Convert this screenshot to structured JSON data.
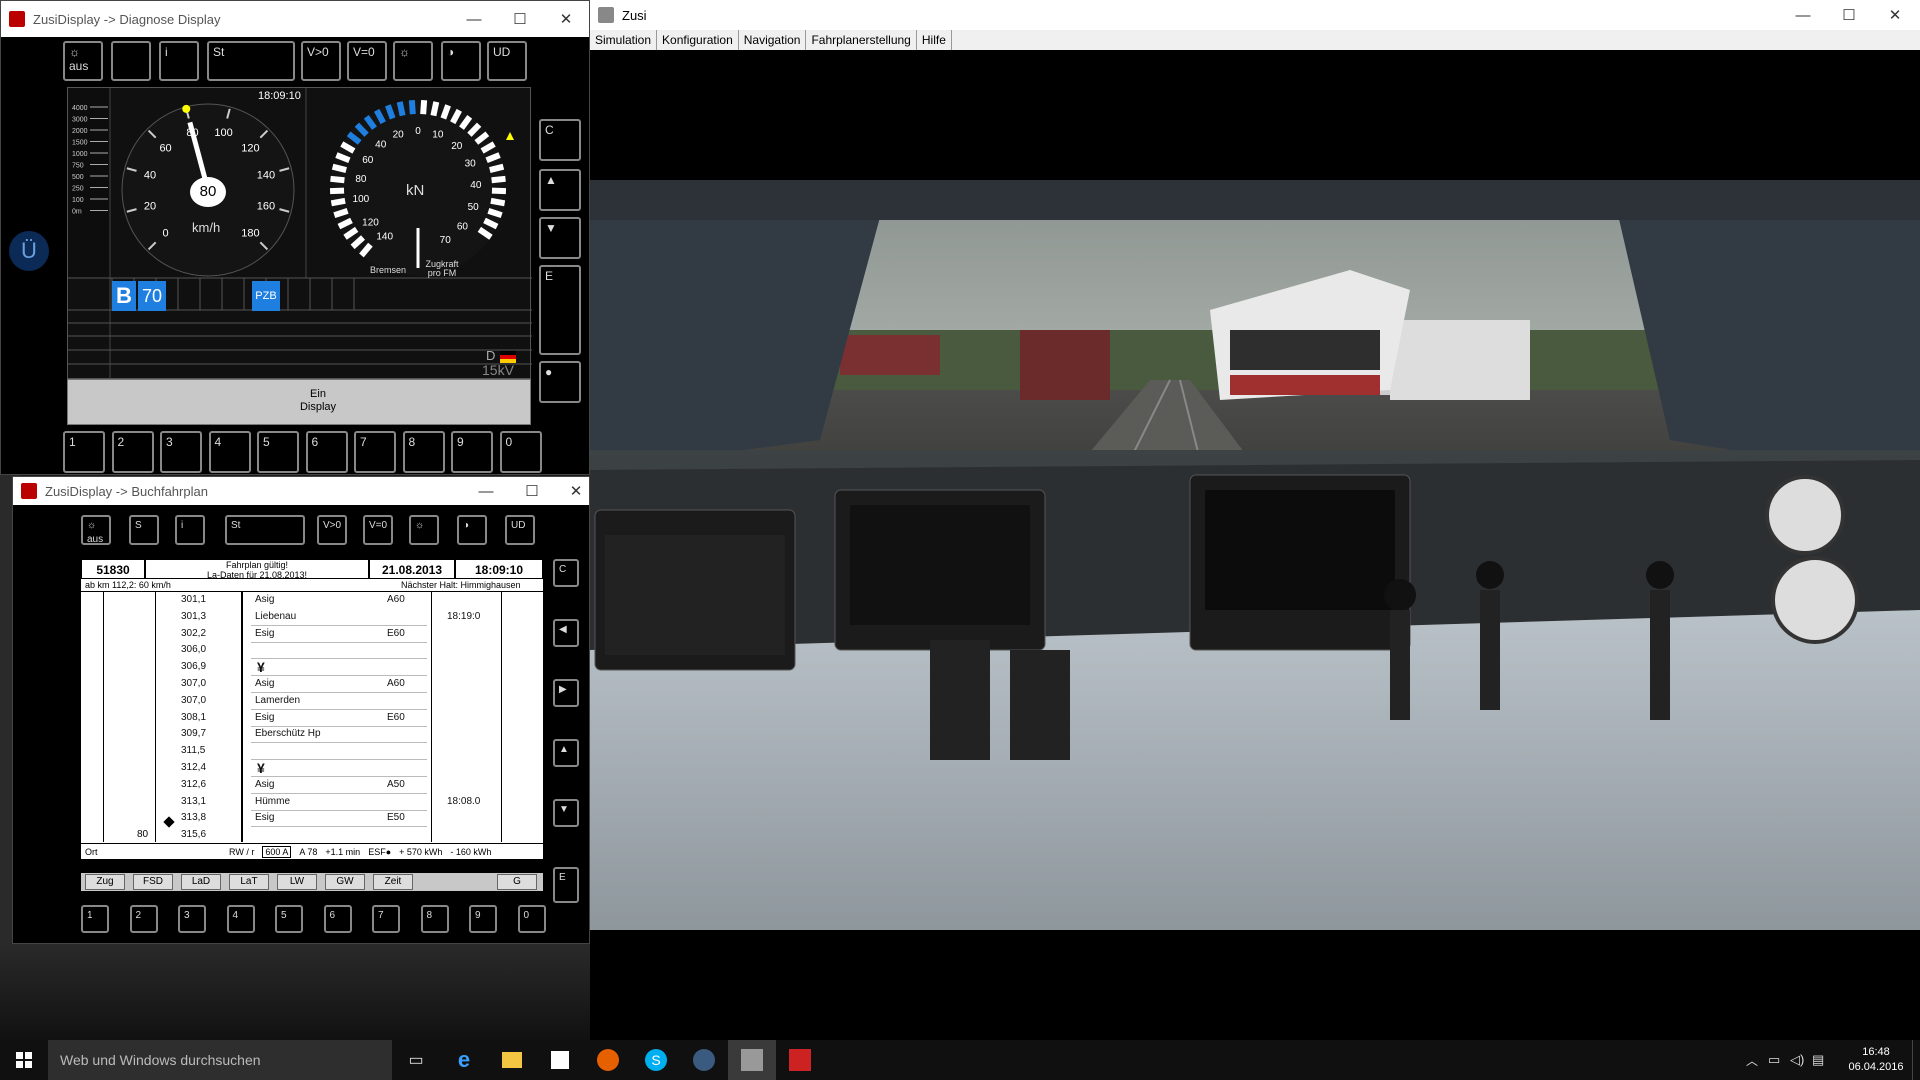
{
  "diag": {
    "title": "ZusiDisplay -> Diagnose Display",
    "time": "18:09:10",
    "top_buttons": [
      "☼ aus",
      "",
      "i",
      "St",
      "V>0",
      "V=0",
      "☼",
      "◑",
      "UD"
    ],
    "speed": {
      "value": "80",
      "unit": "km/h",
      "ticks": [
        "0",
        "20",
        "40",
        "60",
        "80",
        "100",
        "120",
        "140",
        "160",
        "180"
      ]
    },
    "force": {
      "unit": "kN",
      "label_left": "Bremsen",
      "label_right": "Zugkraft pro FM",
      "ticks_left": [
        "100",
        "80",
        "60",
        "40",
        "20"
      ],
      "ticks_right": [
        "10",
        "20",
        "30",
        "40",
        "50",
        "60",
        "70"
      ],
      "ticks_outer_left": [
        "120",
        "140"
      ],
      "zero": "0"
    },
    "altitude_scale": [
      "4000",
      "3000",
      "2000",
      "1500",
      "1000",
      "750",
      "500",
      "250",
      "100",
      "0m"
    ],
    "lzb": {
      "letter": "B",
      "speed": "70",
      "pzb": "PZB"
    },
    "system": {
      "label": "D",
      "voltage": "15kV"
    },
    "bottom_label": "Ein Display",
    "side_buttons": [
      "C",
      "▲",
      "▼",
      "E",
      "●"
    ],
    "num_buttons": [
      "1",
      "2",
      "3",
      "4",
      "5",
      "6",
      "7",
      "8",
      "9",
      "0"
    ]
  },
  "buch": {
    "title": "ZusiDisplay -> Buchfahrplan",
    "top_buttons": [
      "☼ aus",
      "S",
      "i",
      "St",
      "V>0",
      "V=0",
      "☼",
      "◑",
      "UD"
    ],
    "header": {
      "zug": "51830",
      "fp1": "Fahrplan gültig!",
      "fp2": "La-Daten für 21.08.2013!",
      "date": "21.08.2013",
      "time": "18:09:10",
      "left": "ab km 112,2: 60 km/h",
      "right": "Nächster Halt: Himmighausen"
    },
    "rows": [
      {
        "km": "301,1",
        "name": "Asig",
        "sig": "A60",
        "t": "",
        "mark": ""
      },
      {
        "km": "301,3",
        "name": "Liebenau",
        "sig": "",
        "t": "18:19:0",
        "mark": ""
      },
      {
        "km": "302,2",
        "name": "Esig",
        "sig": "E60",
        "t": "",
        "mark": ""
      },
      {
        "km": "306,0",
        "name": "",
        "sig": "",
        "t": "",
        "mark": ""
      },
      {
        "km": "306,9",
        "name": "",
        "sig": "",
        "t": "",
        "mark": "¥"
      },
      {
        "km": "307,0",
        "name": "Asig",
        "sig": "A60",
        "t": "",
        "mark": ""
      },
      {
        "km": "307,0",
        "name": "Lamerden",
        "sig": "",
        "t": "",
        "mark": ""
      },
      {
        "km": "308,1",
        "name": "Esig",
        "sig": "E60",
        "t": "",
        "mark": ""
      },
      {
        "km": "309,7",
        "name": "Eberschütz Hp",
        "sig": "",
        "t": "",
        "mark": ""
      },
      {
        "km": "311,5",
        "name": "",
        "sig": "",
        "t": "",
        "mark": ""
      },
      {
        "km": "312,4",
        "name": "",
        "sig": "",
        "t": "",
        "mark": "¥"
      },
      {
        "km": "312,6",
        "name": "Asig",
        "sig": "A50",
        "t": "",
        "mark": ""
      },
      {
        "km": "313,1",
        "name": "Hümme",
        "sig": "",
        "t": "18:08.0",
        "mark": ""
      },
      {
        "km": "313,8",
        "name": "Esig",
        "sig": "E50",
        "t": "",
        "mark": ""
      },
      {
        "km": "315,6",
        "name": "",
        "sig": "",
        "t": "",
        "mark": ""
      }
    ],
    "speed_mark": "80",
    "footer": {
      "ort": "Ort",
      "rw": "RW / r",
      "rwval": "600 A",
      "a": "A 78",
      "min": "+1.1 min",
      "esf": "ESF●",
      "kwh1": "+ 570 kWh",
      "kwh2": "- 160 kWh"
    },
    "tabs": [
      "Zug",
      "FSD",
      "LaD",
      "LaT",
      "LW",
      "GW",
      "Zeit",
      "G"
    ],
    "side_buttons": [
      "C",
      "◀",
      "▶",
      "▲",
      "▼",
      "E"
    ],
    "num_buttons": [
      "1",
      "2",
      "3",
      "4",
      "5",
      "6",
      "7",
      "8",
      "9",
      "0"
    ]
  },
  "zusi": {
    "title": "Zusi",
    "menu": [
      "Simulation",
      "Konfiguration",
      "Navigation",
      "Fahrplanerstellung",
      "Hilfe"
    ]
  },
  "taskbar": {
    "search": "Web und Windows durchsuchen",
    "time": "16:48",
    "date": "06.04.2016"
  }
}
